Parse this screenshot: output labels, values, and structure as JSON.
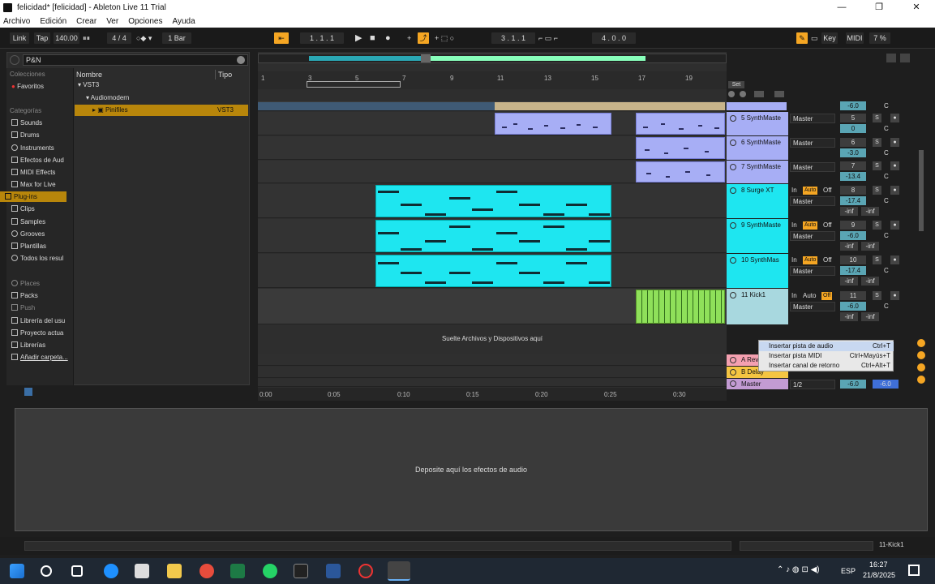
{
  "window": {
    "title": "felicidad* [felicidad] - Ableton Live 11 Trial",
    "min": "—",
    "max": "❐",
    "close": "✕"
  },
  "menu": [
    "Archivo",
    "Edición",
    "Crear",
    "Ver",
    "Opciones",
    "Ayuda"
  ],
  "control": {
    "link": "Link",
    "tap": "Tap",
    "tempo": "140.00",
    "sig": "4 / 4",
    "quant": "1 Bar",
    "pos": "1 . 1 . 1",
    "loop_start": "3 . 1 . 1",
    "loop_len": "4 . 0 . 0",
    "key": "Key",
    "midi": "MIDI",
    "cpu": "7 %"
  },
  "browser": {
    "search_value": "P&N",
    "colecciones": "Colecciones",
    "favoritos": "Favoritos",
    "categorias": "Categorías",
    "categories": [
      "Sounds",
      "Drums",
      "Instruments",
      "Efectos de Aud",
      "MIDI Effects",
      "Max for Live",
      "Plug-ins",
      "Clips",
      "Samples",
      "Grooves",
      "Plantillas",
      "Todos los resul"
    ],
    "places": [
      "Places",
      "Packs",
      "Push",
      "Librería del usu",
      "Proyecto actua",
      "Librerías",
      "Añadir carpeta..."
    ],
    "col_name": "Nombre",
    "col_type": "Tipo",
    "tree": [
      {
        "label": "VST3",
        "type": ""
      },
      {
        "label": "Audiomodern",
        "type": ""
      },
      {
        "label": "Pinifiles",
        "type": "VST3"
      }
    ]
  },
  "arrangement": {
    "ruler": [
      "1",
      "3",
      "5",
      "7",
      "9",
      "11",
      "13",
      "15",
      "17",
      "19"
    ],
    "drop_text": "Suelte Archivos y Dispositivos aquí",
    "set": "Set",
    "time": [
      "0:00",
      "0:05",
      "0:10",
      "0:15",
      "0:20",
      "0:25",
      "0:30"
    ]
  },
  "tracks": [
    {
      "name": "5 SynthMaste",
      "color": "#a7aef5",
      "io": "Master",
      "n": "5",
      "vol": "0",
      "pan": "C",
      "sel": false
    },
    {
      "name": "6 SynthMaste",
      "color": "#a7aef5",
      "io": "Master",
      "n": "6",
      "vol": "-3.0",
      "pan": "C",
      "sel": false
    },
    {
      "name": "7 SynthMaste",
      "color": "#a7aef5",
      "io": "Master",
      "n": "7",
      "vol": "-13.4",
      "pan": "C",
      "sel": false
    },
    {
      "name": "8 Surge XT",
      "color": "#1ee6f0",
      "io": "Master",
      "n": "8",
      "vol": "-17.4",
      "pan": "C",
      "sel": false
    },
    {
      "name": "9 SynthMaste",
      "color": "#1ee6f0",
      "io": "Master",
      "n": "9",
      "vol": "-6.0",
      "pan": "C",
      "sel": false
    },
    {
      "name": "10 SynthMas",
      "color": "#1ee6f0",
      "io": "Master",
      "n": "10",
      "vol": "-17.4",
      "pan": "C",
      "sel": false
    },
    {
      "name": "11 Kick1",
      "color": "#a8d8df",
      "io": "Master",
      "n": "11",
      "vol": "-6.0",
      "pan": "C",
      "sel": true
    }
  ],
  "mixer_labels": {
    "in": "In",
    "auto": "Auto",
    "off": "Off",
    "inf": "-inf",
    "s": "S"
  },
  "return_tracks": [
    {
      "name": "A Rev",
      "color": "#f4a0b0"
    },
    {
      "name": "B Delay",
      "color": "#f5c542"
    },
    {
      "name": "Master",
      "color": "#c39bd3"
    }
  ],
  "master": {
    "sel": "1/2",
    "vol": "-6.0",
    "top_vol": "-6.0"
  },
  "context_menu": [
    {
      "label": "Insertar pista de audio",
      "shortcut": "Ctrl+T"
    },
    {
      "label": "Insertar pista MIDI",
      "shortcut": "Ctrl+Mayús+T"
    },
    {
      "label": "Insertar canal de retorno",
      "shortcut": "Ctrl+Alt+T"
    }
  ],
  "device": {
    "drop_text": "Deposite aquí los efectos de audio"
  },
  "status": {
    "track": "11-Kick1"
  },
  "taskbar": {
    "lang": "ESP",
    "time": "16:27",
    "date": "21/8/2025"
  },
  "colors": {
    "accent": "#f5a623",
    "cyan_clip": "#1ee6f0",
    "lavender_clip": "#a7aef5",
    "kick_clip": "#8fe05a"
  }
}
